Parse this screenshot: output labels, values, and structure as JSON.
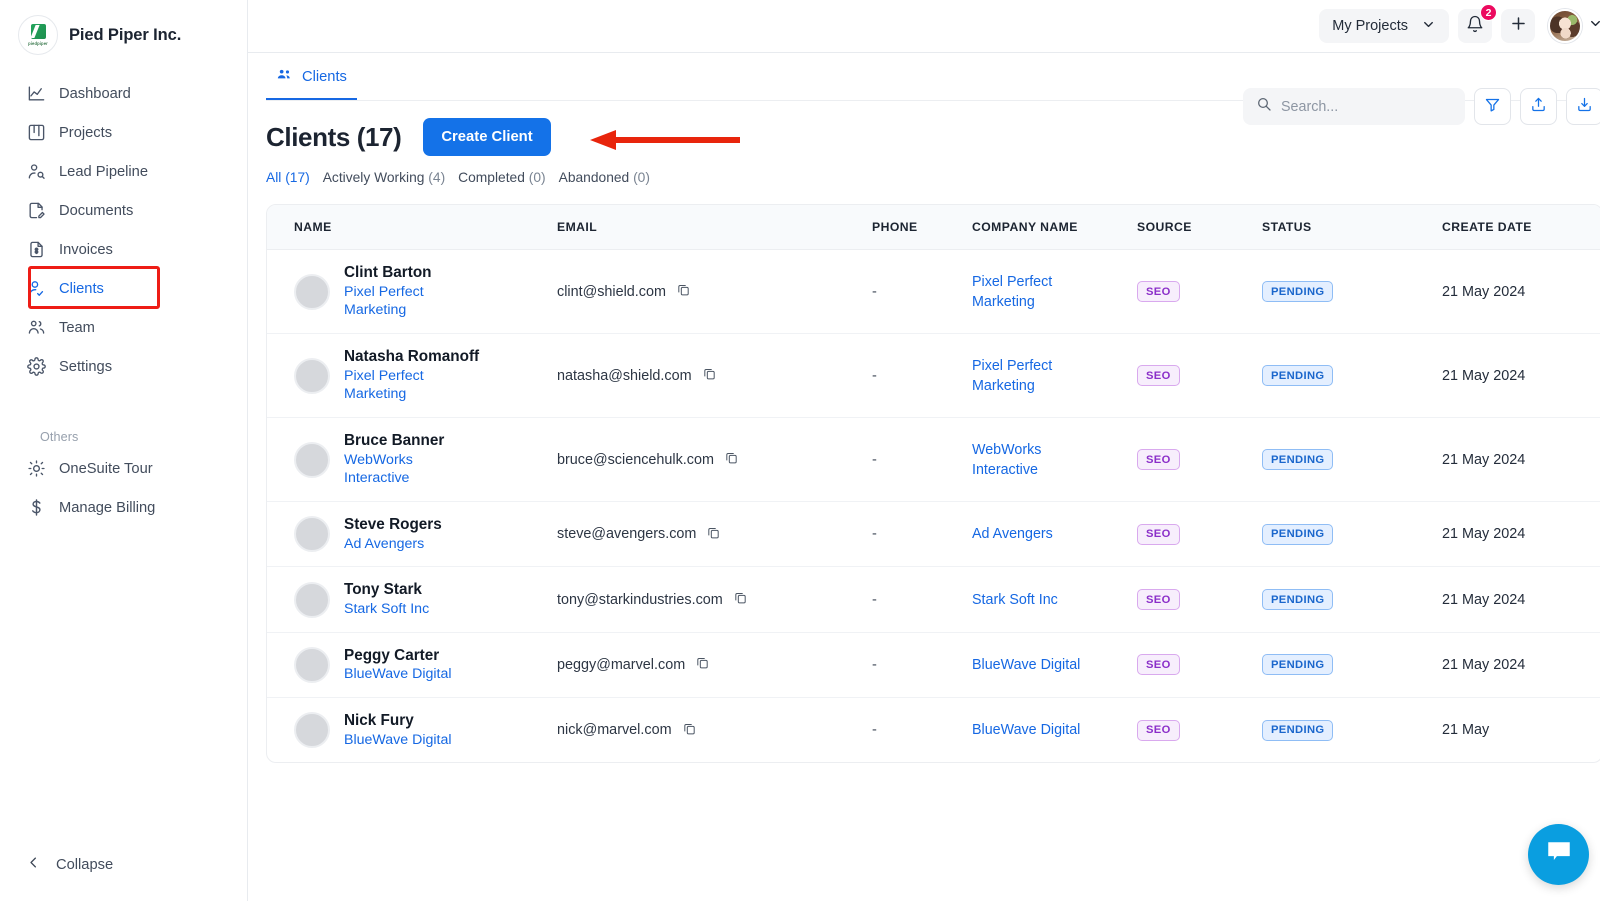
{
  "brand": {
    "name": "Pied Piper Inc.",
    "logo_text": "piedpiper"
  },
  "sidebar": {
    "items": [
      {
        "label": "Dashboard",
        "icon": "chart-line-icon",
        "active": false
      },
      {
        "label": "Projects",
        "icon": "kanban-board-icon",
        "active": false
      },
      {
        "label": "Lead Pipeline",
        "icon": "user-search-icon",
        "active": false
      },
      {
        "label": "Documents",
        "icon": "document-edit-icon",
        "active": false
      },
      {
        "label": "Invoices",
        "icon": "invoice-dollar-icon",
        "active": false
      },
      {
        "label": "Clients",
        "icon": "user-check-icon",
        "active": true
      },
      {
        "label": "Team",
        "icon": "users-group-icon",
        "active": false
      },
      {
        "label": "Settings",
        "icon": "gear-icon",
        "active": false
      }
    ],
    "others_label": "Others",
    "others": [
      {
        "label": "OneSuite Tour",
        "icon": "sun-tour-icon"
      },
      {
        "label": "Manage Billing",
        "icon": "dollar-sign-icon"
      }
    ],
    "collapse_label": "Collapse",
    "collapse_icon": "chevron-left-icon"
  },
  "topbar": {
    "project_selector": "My Projects",
    "project_selector_icon": "chevron-down-icon",
    "notifications_icon": "bell-icon",
    "notifications_count": "2",
    "add_icon": "plus-icon",
    "avatar_icon": "user-avatar",
    "avatar_caret_icon": "chevron-down-icon"
  },
  "tab": {
    "label": "Clients",
    "icon": "people-group-icon"
  },
  "page": {
    "title": "Clients",
    "count": "(17)",
    "create_button": "Create Client",
    "annotation": "red-arrow-pointing-left-at-create-client"
  },
  "filters": [
    {
      "label": "All",
      "count": "(17)",
      "active": true
    },
    {
      "label": "Actively Working",
      "count": "(4)",
      "active": false
    },
    {
      "label": "Completed",
      "count": "(0)",
      "active": false
    },
    {
      "label": "Abandoned",
      "count": "(0)",
      "active": false
    }
  ],
  "search": {
    "placeholder": "Search...",
    "value": "",
    "icon": "search-icon"
  },
  "toolbar": {
    "filter_icon": "funnel-filter-icon",
    "upload_icon": "upload-icon",
    "download_icon": "download-icon"
  },
  "table": {
    "columns": [
      "NAME",
      "EMAIL",
      "PHONE",
      "COMPANY NAME",
      "SOURCE",
      "STATUS",
      "CREATE DATE"
    ],
    "rows": [
      {
        "name": "Clint Barton",
        "sub_company": "Pixel Perfect Marketing",
        "email": "clint@shield.com",
        "phone": "-",
        "company": "Pixel Perfect Marketing",
        "source": "SEO",
        "status": "PENDING",
        "create_date": "21 May 2024"
      },
      {
        "name": "Natasha Romanoff",
        "sub_company": "Pixel Perfect Marketing",
        "email": "natasha@shield.com",
        "phone": "-",
        "company": "Pixel Perfect Marketing",
        "source": "SEO",
        "status": "PENDING",
        "create_date": "21 May 2024"
      },
      {
        "name": "Bruce Banner",
        "sub_company": "WebWorks Interactive",
        "email": "bruce@sciencehulk.com",
        "phone": "-",
        "company": "WebWorks Interactive",
        "source": "SEO",
        "status": "PENDING",
        "create_date": "21 May 2024"
      },
      {
        "name": "Steve Rogers",
        "sub_company": "Ad Avengers",
        "email": "steve@avengers.com",
        "phone": "-",
        "company": "Ad Avengers",
        "source": "SEO",
        "status": "PENDING",
        "create_date": "21 May 2024"
      },
      {
        "name": "Tony Stark",
        "sub_company": "Stark Soft Inc",
        "email": "tony@starkindustries.com",
        "phone": "-",
        "company": "Stark Soft Inc",
        "source": "SEO",
        "status": "PENDING",
        "create_date": "21 May 2024"
      },
      {
        "name": "Peggy Carter",
        "sub_company": "BlueWave Digital",
        "email": "peggy@marvel.com",
        "phone": "-",
        "company": "BlueWave Digital",
        "source": "SEO",
        "status": "PENDING",
        "create_date": "21 May 2024"
      },
      {
        "name": "Nick Fury",
        "sub_company": "BlueWave Digital",
        "email": "nick@marvel.com",
        "phone": "-",
        "company": "BlueWave Digital",
        "source": "SEO",
        "status": "PENDING",
        "create_date": "21 May"
      }
    ]
  },
  "chat": {
    "icon": "chat-bubble-icon"
  },
  "colors": {
    "accent_blue": "#1668e3",
    "primary_button": "#1472e8",
    "annotation_red": "#ee1d16",
    "badge_pink": "#ec0a5f",
    "seo_purple": "#8b2fc9",
    "pending_blue": "#1a66cc",
    "chat_blue": "#0a9ee0"
  }
}
